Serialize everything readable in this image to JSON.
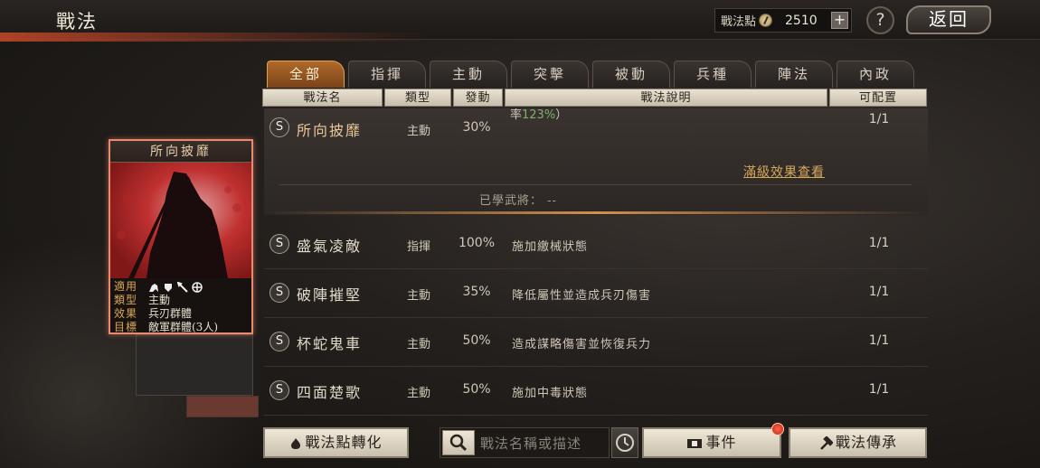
{
  "header": {
    "title": "戰法",
    "points_label": "戰法點",
    "points_value": "2510",
    "plus_label": "+",
    "help_label": "?",
    "back_label": "返回"
  },
  "tabs": [
    {
      "label": "全部",
      "active": true
    },
    {
      "label": "指揮",
      "active": false
    },
    {
      "label": "主動",
      "active": false
    },
    {
      "label": "突擊",
      "active": false
    },
    {
      "label": "被動",
      "active": false
    },
    {
      "label": "兵種",
      "active": false
    },
    {
      "label": "陣法",
      "active": false
    },
    {
      "label": "內政",
      "active": false
    }
  ],
  "columns": [
    "戰法名",
    "類型",
    "發動",
    "戰法說明",
    "可配置"
  ],
  "expanded_row": {
    "grade": "S",
    "name": "所向披靡",
    "type": "主動",
    "rate": "30%",
    "desc_cut_prefix": "率",
    "desc_cut_pct": "123%",
    "desc_cut_suffix": "）",
    "capacity": "1/1",
    "full_effect_link": "滿級效果查看",
    "learned_label": "已學武將：",
    "learned_value": "--"
  },
  "rows": [
    {
      "grade": "S",
      "name": "盛氣凌敵",
      "type": "指揮",
      "rate": "100%",
      "desc": "施加繳械狀態",
      "capacity": "1/1"
    },
    {
      "grade": "S",
      "name": "破陣摧堅",
      "type": "主動",
      "rate": "35%",
      "desc": "降低屬性並造成兵刃傷害",
      "capacity": "1/1"
    },
    {
      "grade": "S",
      "name": "杯蛇鬼車",
      "type": "主動",
      "rate": "50%",
      "desc": "造成謀略傷害並恢復兵力",
      "capacity": "1/1"
    },
    {
      "grade": "S",
      "name": "四面楚歌",
      "type": "主動",
      "rate": "50%",
      "desc": "施加中毒狀態",
      "capacity": "1/1"
    }
  ],
  "card": {
    "title": "所向披靡",
    "apply_label": "適用",
    "type_label": "類型",
    "type_value": "主動",
    "effect_label": "效果",
    "effect_value": "兵刃群體",
    "target_label": "目標",
    "target_value": "敵軍群體(3人)",
    "unit_icons": [
      "cavalry-icon",
      "shield-icon",
      "spear-icon",
      "crossbow-icon"
    ]
  },
  "bottom": {
    "convert_button": "戰法點轉化",
    "search_placeholder": "戰法名稱或描述",
    "events_button": "事件",
    "inherit_button": "戰法傳承"
  }
}
